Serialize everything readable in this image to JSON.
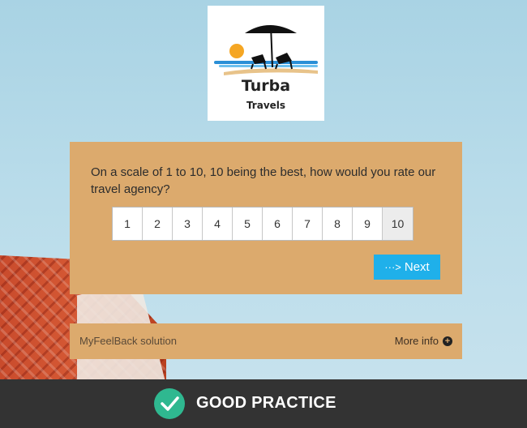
{
  "brand": {
    "name": "Turba",
    "tagline": "Travels",
    "logo_icon": "beach-umbrella-chairs-icon"
  },
  "survey": {
    "question": "On a scale of 1 to 10, 10 being the best, how would you rate our travel agency?",
    "scale": [
      "1",
      "2",
      "3",
      "4",
      "5",
      "6",
      "7",
      "8",
      "9",
      "10"
    ],
    "next_label": "Next",
    "next_icon": "arrow-right-icon",
    "accent_color": "#1fb0ea",
    "card_color": "#dcaa6d"
  },
  "footer": {
    "powered_by": "MyFeelBack solution",
    "more_info": "More info",
    "more_info_icon": "plus-circle-icon"
  },
  "banner": {
    "label": "GOOD PRACTICE",
    "icon": "check-circle-icon",
    "icon_color": "#2fb890"
  }
}
